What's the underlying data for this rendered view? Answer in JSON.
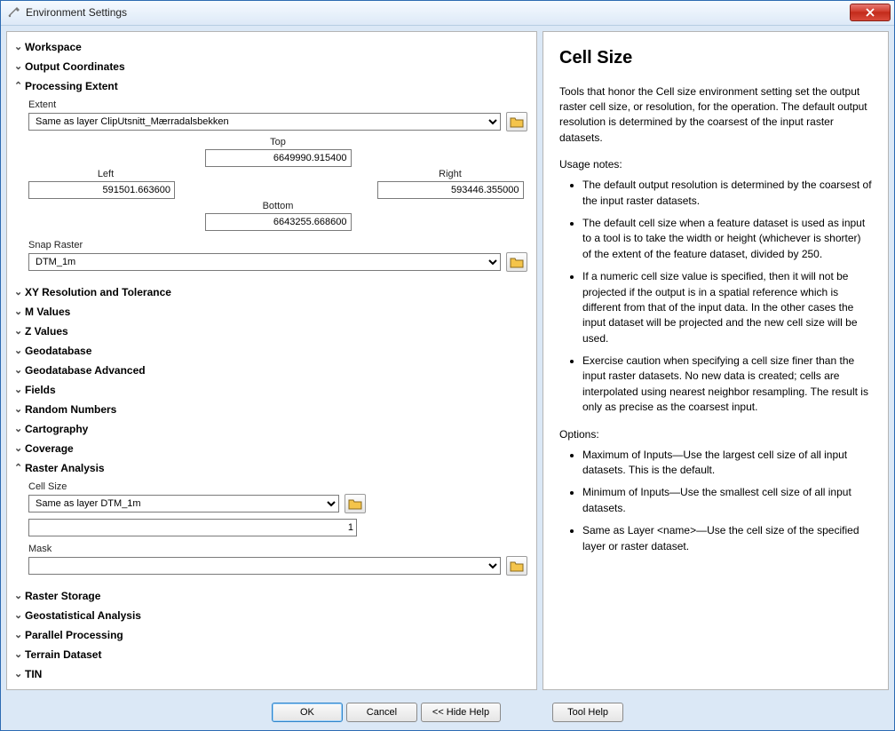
{
  "window": {
    "title": "Environment Settings"
  },
  "sections": {
    "workspace": "Workspace",
    "output_coordinates": "Output Coordinates",
    "processing_extent": "Processing Extent",
    "xy_res": "XY Resolution and Tolerance",
    "m_values": "M Values",
    "z_values": "Z Values",
    "geodb": "Geodatabase",
    "geodb_adv": "Geodatabase Advanced",
    "fields": "Fields",
    "random": "Random Numbers",
    "carto": "Cartography",
    "coverage": "Coverage",
    "raster_analysis": "Raster Analysis",
    "raster_storage": "Raster Storage",
    "geostat": "Geostatistical Analysis",
    "parallel": "Parallel Processing",
    "terrain": "Terrain Dataset",
    "tin": "TIN"
  },
  "processing_extent": {
    "extent_label": "Extent",
    "extent_value": "Same as layer ClipUtsnitt_Mærradalsbekken",
    "top_label": "Top",
    "top": "6649990.915400",
    "left_label": "Left",
    "left": "591501.663600",
    "right_label": "Right",
    "right": "593446.355000",
    "bottom_label": "Bottom",
    "bottom": "6643255.668600",
    "snap_label": "Snap Raster",
    "snap_value": "DTM_1m"
  },
  "raster_analysis": {
    "cellsize_label": "Cell Size",
    "cellsize_value": "Same as layer DTM_1m",
    "cellsize_number": "1",
    "mask_label": "Mask",
    "mask_value": ""
  },
  "help": {
    "title": "Cell Size",
    "intro": "Tools that honor the Cell size environment setting set the output raster cell size, or resolution, for the operation. The default output resolution is determined by the coarsest of the input raster datasets.",
    "usage_heading": "Usage notes:",
    "usage": [
      "The default output resolution is determined by the coarsest of the input raster datasets.",
      "The default cell size when a feature dataset is used as input to a tool is to take the width or height (whichever is shorter) of the extent of the feature dataset, divided by 250.",
      "If a numeric cell size value is specified, then it will not be projected if the output is in a spatial reference which is different from that of the input data. In the other cases the input dataset will be projected and the new cell size will be used.",
      "Exercise caution when specifying a cell size finer than the input raster datasets. No new data is created; cells are interpolated using nearest neighbor resampling. The result is only as precise as the coarsest input."
    ],
    "options_heading": "Options:",
    "options": [
      "Maximum of Inputs—Use the largest cell size of all input datasets. This is the default.",
      "Minimum of Inputs—Use the smallest cell size of all input datasets.",
      "Same as Layer <name>—Use the cell size of the specified layer or raster dataset."
    ]
  },
  "buttons": {
    "ok": "OK",
    "cancel": "Cancel",
    "hide_help": "<< Hide Help",
    "tool_help": "Tool Help"
  }
}
